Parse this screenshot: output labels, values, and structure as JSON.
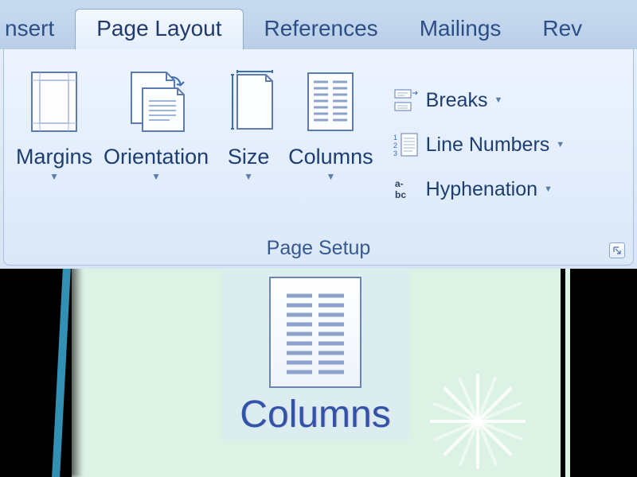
{
  "tabs": {
    "insert": "nsert",
    "page_layout": "Page Layout",
    "references": "References",
    "mailings": "Mailings",
    "review": "Rev"
  },
  "group": {
    "title": "Page Setup",
    "margins": "Margins",
    "orientation": "Orientation",
    "size": "Size",
    "columns": "Columns",
    "breaks": "Breaks",
    "line_numbers": "Line Numbers",
    "hyphenation": "Hyphenation"
  },
  "callout": {
    "label": "Columns"
  }
}
